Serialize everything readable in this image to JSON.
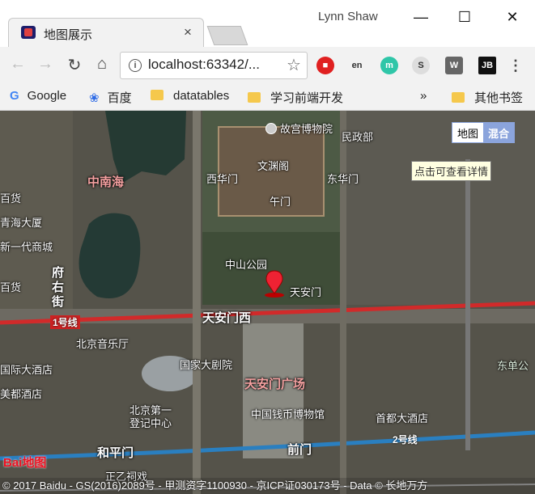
{
  "browser": {
    "tab_title": "地图展示",
    "tab_close": "×",
    "user": "Lynn Shaw",
    "minimize": "—",
    "maximize": "☐",
    "close": "✕",
    "url": "localhost:63342/...",
    "back": "←",
    "forward": "→",
    "reload": "↻",
    "home": "⌂",
    "star": "☆",
    "bookmarks": [
      "Google",
      "百度",
      "datatables",
      "学习前端开发"
    ],
    "more_bookmarks": "»",
    "other_bookmarks": "其他书签"
  },
  "map": {
    "maptype_map": "地图",
    "maptype_hybrid": "混合",
    "tooltip": "点击可查看详情",
    "marker_label": "天安门",
    "labels": {
      "gugong": "故宫博物院",
      "minzheng": "民政部",
      "wenyuan": "文渊阁",
      "xihuamen": "西华门",
      "donghuamen": "东华门",
      "wumen": "午门",
      "zhongnanhai": "中南海",
      "baihuo1": "百货",
      "qinghai": "青海大厦",
      "xinyidai": "新一代商城",
      "baihuo2": "百货",
      "fuyoujie": "府右街",
      "zhongshan": "中山公园",
      "tiananmenxi": "天安门西",
      "line1": "1号线",
      "yinyueting": "北京音乐厅",
      "guojiadajuyuan": "国家大剧院",
      "guojidasha": "国际大酒店",
      "meidu": "美都酒店",
      "guangchang": "天安门广场",
      "dijiyi": "北京第一",
      "dengji": "登记中心",
      "qianbi": "中国钱币博物馆",
      "shoudu": "首都大酒店",
      "dongdan": "东单公",
      "line2": "2号线",
      "hepingmen": "和平门",
      "qianmen": "前门",
      "zhengyang": "正乙祠戏"
    },
    "copyright": "© 2017 Baidu - GS(2016)2089号 - 甲测资字1100930 - 京ICP证030173号 - Data © 长地万方",
    "logo": "Bai地图"
  }
}
